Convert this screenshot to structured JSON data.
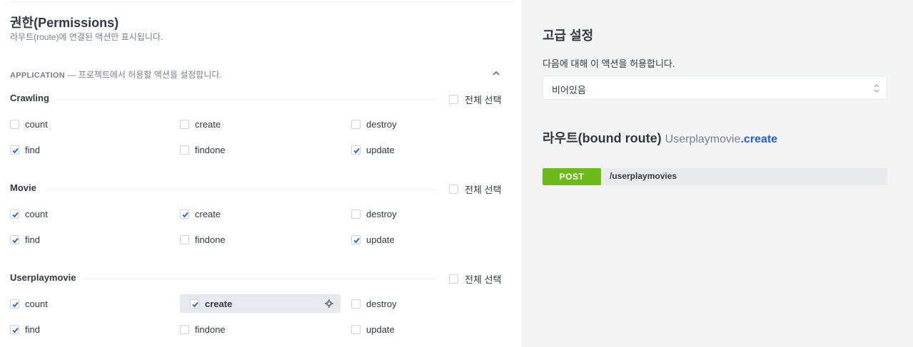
{
  "permissions": {
    "title": "권한(Permissions)",
    "subtitle": "라우트(route)에 연결된 액션만 표시됩니다."
  },
  "application": {
    "name": "APPLICATION",
    "description": " — 프로젝트에서 허용할 액션을 설정합니다."
  },
  "controllers": [
    {
      "name": "Crawling",
      "select_all_label": "전체 선택",
      "actions": [
        {
          "label": "count",
          "checked": false
        },
        {
          "label": "create",
          "checked": false
        },
        {
          "label": "destroy",
          "checked": false
        },
        {
          "label": "find",
          "checked": true
        },
        {
          "label": "findone",
          "checked": false
        },
        {
          "label": "update",
          "checked": true
        }
      ]
    },
    {
      "name": "Movie",
      "select_all_label": "전체 선택",
      "actions": [
        {
          "label": "count",
          "checked": true
        },
        {
          "label": "create",
          "checked": true
        },
        {
          "label": "destroy",
          "checked": false
        },
        {
          "label": "find",
          "checked": true
        },
        {
          "label": "findone",
          "checked": false
        },
        {
          "label": "update",
          "checked": true
        }
      ]
    },
    {
      "name": "Userplaymovie",
      "select_all_label": "전체 선택",
      "actions": [
        {
          "label": "count",
          "checked": true
        },
        {
          "label": "create",
          "checked": true,
          "highlighted": true
        },
        {
          "label": "destroy",
          "checked": false
        },
        {
          "label": "find",
          "checked": true
        },
        {
          "label": "findone",
          "checked": false
        },
        {
          "label": "update",
          "checked": false
        }
      ]
    }
  ],
  "advanced": {
    "title": "고급 설정",
    "allow_label": "다음에 대해 이 액션을 허용합니다.",
    "select_value": "비어있음"
  },
  "route": {
    "title": "라우트(bound route)",
    "controller": "Userplaymovie",
    "action": ".create",
    "method": "POST",
    "path": "/userplaymovies"
  },
  "colors": {
    "accent": "#1c5de7",
    "post_badge": "#6dbb1a",
    "panel_bg": "#f4f4f4",
    "highlight_bg": "#e6e9ee"
  }
}
